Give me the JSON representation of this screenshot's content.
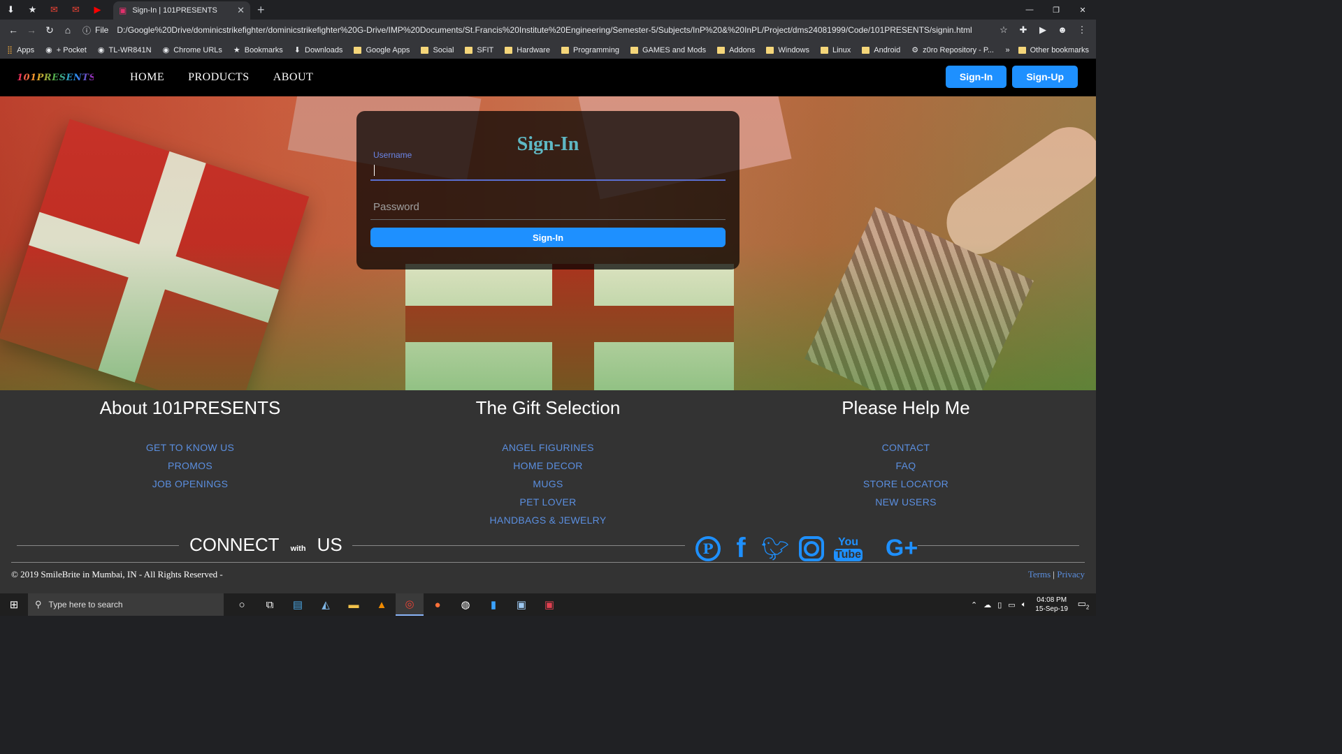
{
  "browser": {
    "pinned_tabs": [
      "download-icon",
      "star-icon",
      "gmail-icon",
      "gmail-icon",
      "youtube-icon"
    ],
    "active_tab": {
      "title": "Sign-In | 101PRESENTS"
    },
    "omnibox": {
      "scheme_label": "File",
      "url": "D:/Google%20Drive/dominicstrikefighter/dominicstrikefighter%20G-Drive/IMP%20Documents/St.Francis%20Institute%20Engineering/Semester-5/Subjects/InP%20&%20InPL/Project/dms24081999/Code/101PRESENTS/signin.html"
    },
    "bookmarks": [
      {
        "label": "Apps",
        "icon": "apps-grid"
      },
      {
        "label": "+ Pocket",
        "icon": "globe"
      },
      {
        "label": "TL-WR841N",
        "icon": "globe"
      },
      {
        "label": "Chrome URLs",
        "icon": "globe"
      },
      {
        "label": "Bookmarks",
        "icon": "star"
      },
      {
        "label": "Downloads",
        "icon": "download"
      },
      {
        "label": "Google Apps",
        "icon": "folder"
      },
      {
        "label": "Social",
        "icon": "folder"
      },
      {
        "label": "SFIT",
        "icon": "folder"
      },
      {
        "label": "Hardware",
        "icon": "folder"
      },
      {
        "label": "Programming",
        "icon": "folder"
      },
      {
        "label": "GAMES and Mods",
        "icon": "folder"
      },
      {
        "label": "Addons",
        "icon": "folder"
      },
      {
        "label": "Windows",
        "icon": "folder"
      },
      {
        "label": "Linux",
        "icon": "folder"
      },
      {
        "label": "Android",
        "icon": "folder"
      },
      {
        "label": "z0ro Repository - P...",
        "icon": "gear"
      }
    ],
    "other_bookmarks": "Other bookmarks",
    "overflow": "»"
  },
  "site": {
    "logo_text": "101PRESENTS",
    "nav": {
      "home": "HOME",
      "products": "PRODUCTS",
      "about": "ABOUT"
    },
    "nav_buttons": {
      "signin": "Sign-In",
      "signup": "Sign-Up"
    },
    "login": {
      "title": "Sign-In",
      "username_label": "Username",
      "password_placeholder": "Password",
      "submit": "Sign-In"
    },
    "footer": {
      "about": {
        "title": "About 101PRESENTS",
        "links": [
          "GET TO KNOW US",
          "PROMOS",
          "JOB OPENINGS"
        ]
      },
      "gifts": {
        "title": "The Gift Selection",
        "links": [
          "ANGEL FIGURINES",
          "HOME DECOR",
          "MUGS",
          "PET LOVER",
          "HANDBAGS & JEWELRY"
        ]
      },
      "help": {
        "title": "Please Help Me",
        "links": [
          "CONTACT",
          "FAQ",
          "STORE LOCATOR",
          "NEW USERS"
        ]
      },
      "connect": {
        "left": "CONNECT",
        "with": "with",
        "right": "US"
      },
      "socials": {
        "pinterest": "P",
        "facebook": "f",
        "youtube_you": "You",
        "youtube_tube": "Tube",
        "googleplus": "G+"
      },
      "copyright": "© 2019 SmileBrite in Mumbai, IN - All Rights Reserved -",
      "terms": "Terms",
      "separator": "|",
      "privacy": "Privacy"
    },
    "accent_color": "#1e90ff"
  },
  "taskbar": {
    "search_placeholder": "Type here to search",
    "time": "04:08 PM",
    "date": "15-Sep-19",
    "notification_count": "2"
  }
}
